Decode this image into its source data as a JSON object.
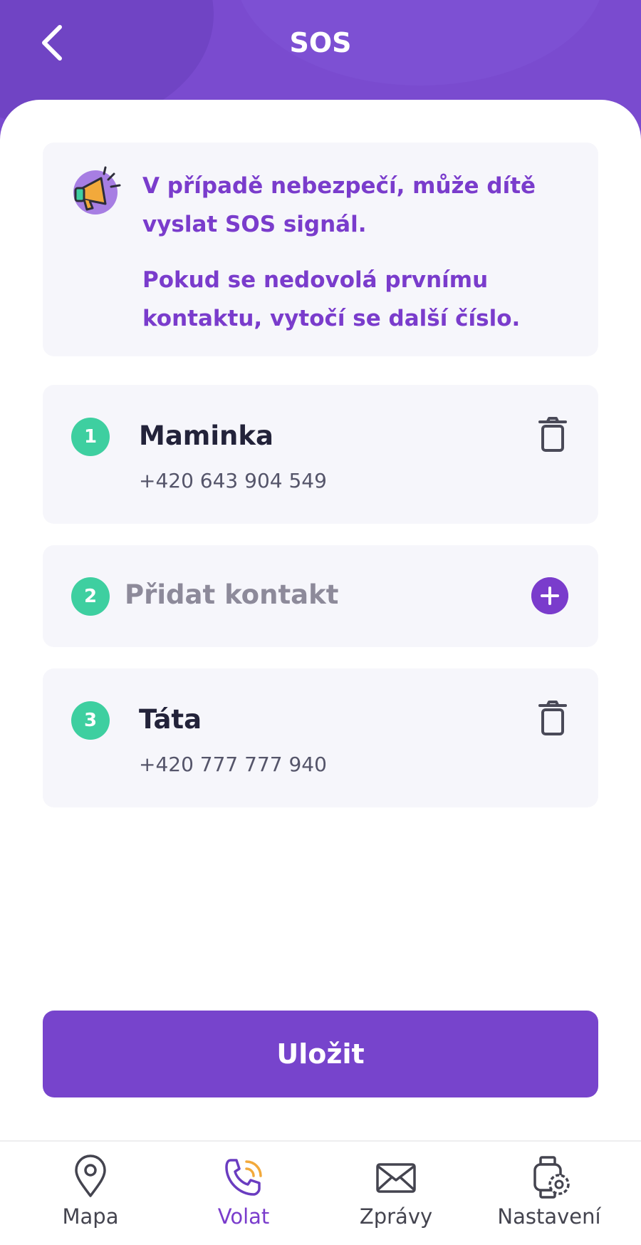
{
  "header": {
    "title": "SOS"
  },
  "info": {
    "line1": "V případě nebezpečí, může dítě vyslat SOS signál.",
    "line2": "Pokud se nedovolá prvnímu kontaktu, vytočí se další číslo."
  },
  "contacts": [
    {
      "number": "1",
      "name": "Maminka",
      "phone": "+420 643 904 549"
    },
    {
      "number": "2",
      "add_label": "Přidat kontakt"
    },
    {
      "number": "3",
      "name": "Táta",
      "phone": "+420 777 777 940"
    }
  ],
  "save_label": "Uložit",
  "nav": [
    {
      "label": "Mapa",
      "icon": "map-pin-icon"
    },
    {
      "label": "Volat",
      "icon": "phone-call-icon",
      "active": true
    },
    {
      "label": "Zprávy",
      "icon": "envelope-icon"
    },
    {
      "label": "Nastavení",
      "icon": "watch-settings-icon"
    }
  ],
  "colors": {
    "brand": "#7a4bcf",
    "accent_text": "#7a3ccc",
    "badge": "#3ecfa0",
    "card_bg": "#f6f6fb"
  }
}
